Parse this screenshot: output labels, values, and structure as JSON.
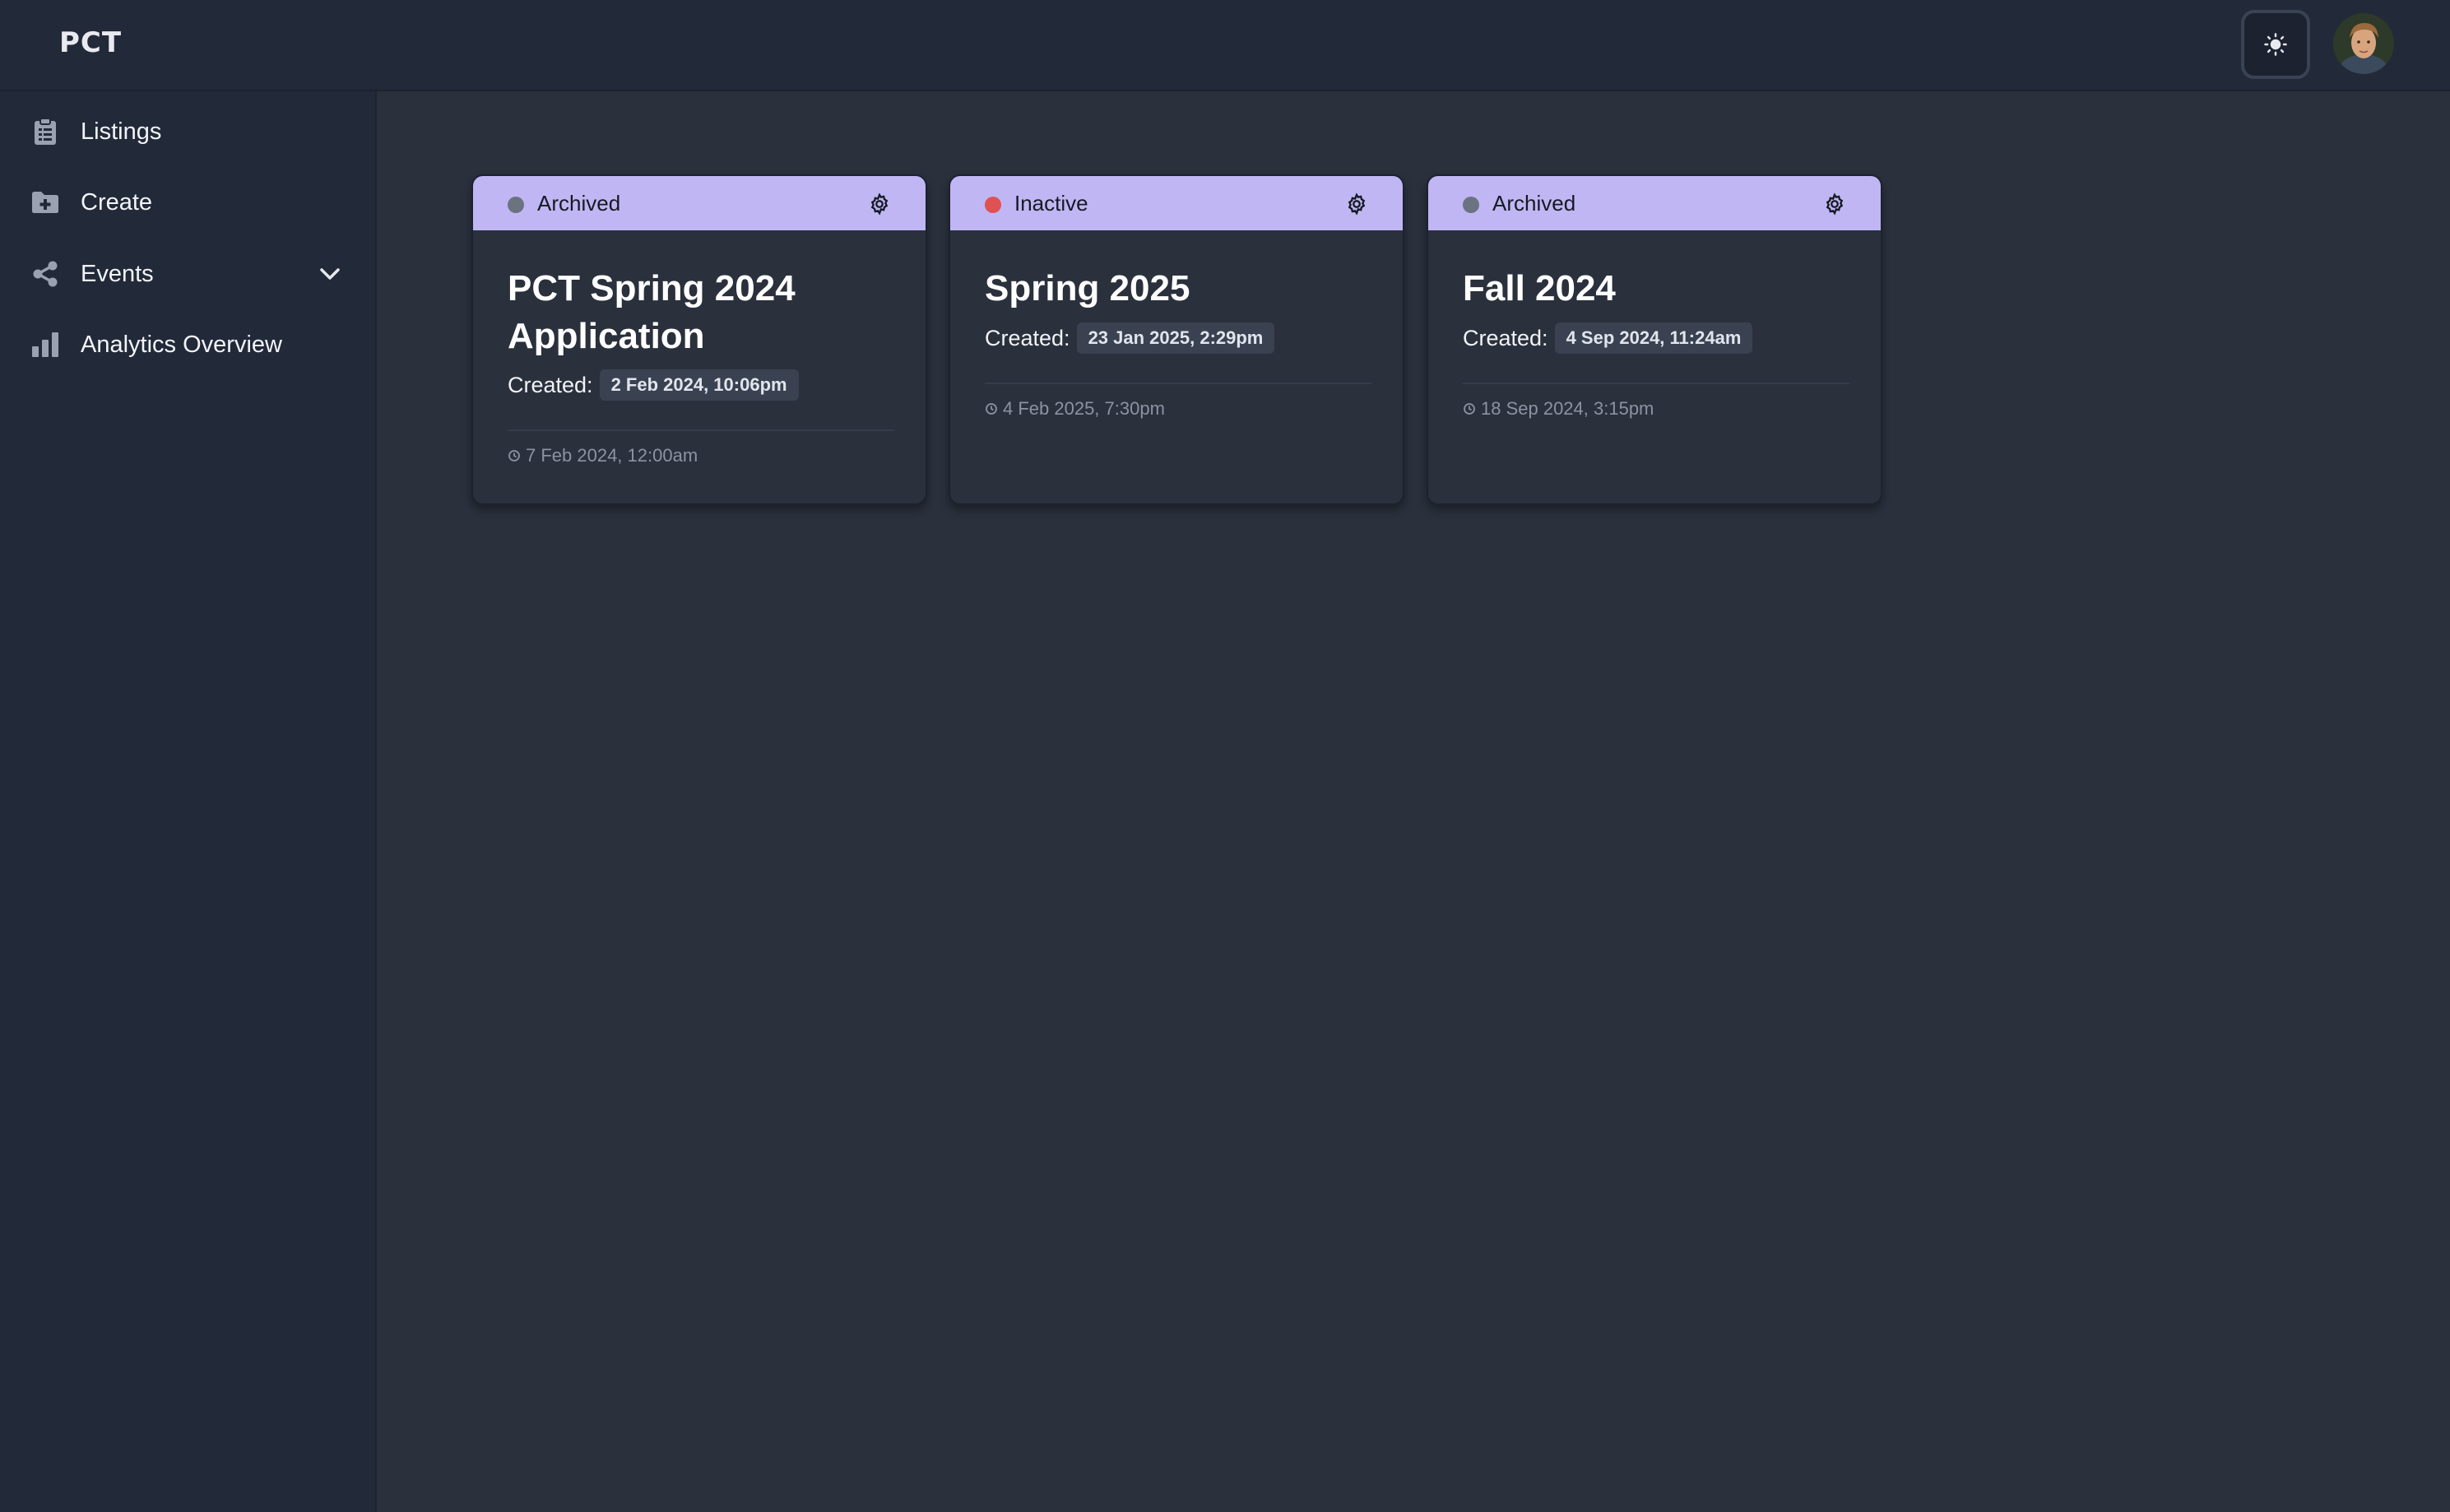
{
  "app": {
    "logo": "PCT"
  },
  "header": {
    "theme_toggle_icon": "sun-icon",
    "avatar_icon": "user-avatar"
  },
  "sidebar": {
    "items": [
      {
        "label": "Listings",
        "icon": "clipboard-icon"
      },
      {
        "label": "Create",
        "icon": "folder-plus-icon"
      },
      {
        "label": "Events",
        "icon": "share-icon",
        "expandable": true
      },
      {
        "label": "Analytics Overview",
        "icon": "bar-chart-icon"
      }
    ]
  },
  "colors": {
    "card_header": "#c0b6f4",
    "status_archived": "#6b7280",
    "status_inactive": "#e05252"
  },
  "cards": [
    {
      "status": "Archived",
      "title": "PCT Spring 2024 Application",
      "created_label": "Created:",
      "created": "2 Feb 2024, 10:06pm",
      "modified": "7 Feb 2024, 12:00am"
    },
    {
      "status": "Inactive",
      "title": "Spring 2025",
      "created_label": "Created:",
      "created": "23 Jan 2025, 2:29pm",
      "modified": "4 Feb 2025, 7:30pm"
    },
    {
      "status": "Archived",
      "title": "Fall 2024",
      "created_label": "Created:",
      "created": "4 Sep 2024, 11:24am",
      "modified": "18 Sep 2024, 3:15pm"
    }
  ]
}
